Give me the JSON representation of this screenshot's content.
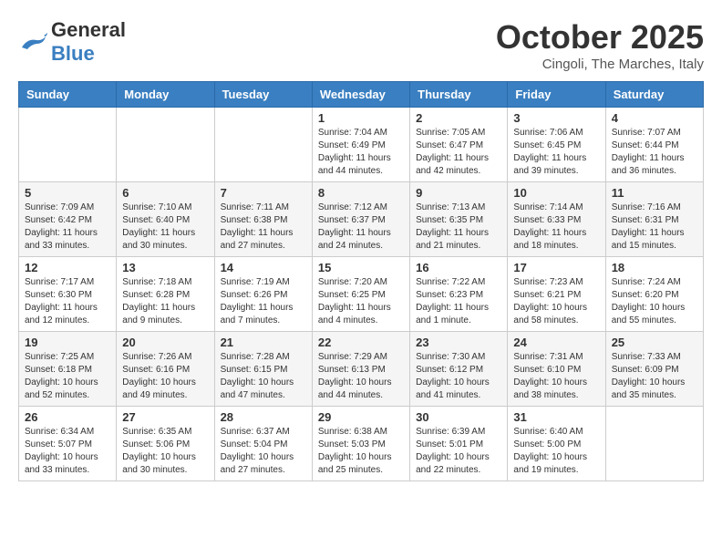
{
  "header": {
    "logo_general": "General",
    "logo_blue": "Blue",
    "month": "October 2025",
    "location": "Cingoli, The Marches, Italy"
  },
  "weekdays": [
    "Sunday",
    "Monday",
    "Tuesday",
    "Wednesday",
    "Thursday",
    "Friday",
    "Saturday"
  ],
  "weeks": [
    [
      {
        "day": "",
        "info": ""
      },
      {
        "day": "",
        "info": ""
      },
      {
        "day": "",
        "info": ""
      },
      {
        "day": "1",
        "info": "Sunrise: 7:04 AM\nSunset: 6:49 PM\nDaylight: 11 hours\nand 44 minutes."
      },
      {
        "day": "2",
        "info": "Sunrise: 7:05 AM\nSunset: 6:47 PM\nDaylight: 11 hours\nand 42 minutes."
      },
      {
        "day": "3",
        "info": "Sunrise: 7:06 AM\nSunset: 6:45 PM\nDaylight: 11 hours\nand 39 minutes."
      },
      {
        "day": "4",
        "info": "Sunrise: 7:07 AM\nSunset: 6:44 PM\nDaylight: 11 hours\nand 36 minutes."
      }
    ],
    [
      {
        "day": "5",
        "info": "Sunrise: 7:09 AM\nSunset: 6:42 PM\nDaylight: 11 hours\nand 33 minutes."
      },
      {
        "day": "6",
        "info": "Sunrise: 7:10 AM\nSunset: 6:40 PM\nDaylight: 11 hours\nand 30 minutes."
      },
      {
        "day": "7",
        "info": "Sunrise: 7:11 AM\nSunset: 6:38 PM\nDaylight: 11 hours\nand 27 minutes."
      },
      {
        "day": "8",
        "info": "Sunrise: 7:12 AM\nSunset: 6:37 PM\nDaylight: 11 hours\nand 24 minutes."
      },
      {
        "day": "9",
        "info": "Sunrise: 7:13 AM\nSunset: 6:35 PM\nDaylight: 11 hours\nand 21 minutes."
      },
      {
        "day": "10",
        "info": "Sunrise: 7:14 AM\nSunset: 6:33 PM\nDaylight: 11 hours\nand 18 minutes."
      },
      {
        "day": "11",
        "info": "Sunrise: 7:16 AM\nSunset: 6:31 PM\nDaylight: 11 hours\nand 15 minutes."
      }
    ],
    [
      {
        "day": "12",
        "info": "Sunrise: 7:17 AM\nSunset: 6:30 PM\nDaylight: 11 hours\nand 12 minutes."
      },
      {
        "day": "13",
        "info": "Sunrise: 7:18 AM\nSunset: 6:28 PM\nDaylight: 11 hours\nand 9 minutes."
      },
      {
        "day": "14",
        "info": "Sunrise: 7:19 AM\nSunset: 6:26 PM\nDaylight: 11 hours\nand 7 minutes."
      },
      {
        "day": "15",
        "info": "Sunrise: 7:20 AM\nSunset: 6:25 PM\nDaylight: 11 hours\nand 4 minutes."
      },
      {
        "day": "16",
        "info": "Sunrise: 7:22 AM\nSunset: 6:23 PM\nDaylight: 11 hours\nand 1 minute."
      },
      {
        "day": "17",
        "info": "Sunrise: 7:23 AM\nSunset: 6:21 PM\nDaylight: 10 hours\nand 58 minutes."
      },
      {
        "day": "18",
        "info": "Sunrise: 7:24 AM\nSunset: 6:20 PM\nDaylight: 10 hours\nand 55 minutes."
      }
    ],
    [
      {
        "day": "19",
        "info": "Sunrise: 7:25 AM\nSunset: 6:18 PM\nDaylight: 10 hours\nand 52 minutes."
      },
      {
        "day": "20",
        "info": "Sunrise: 7:26 AM\nSunset: 6:16 PM\nDaylight: 10 hours\nand 49 minutes."
      },
      {
        "day": "21",
        "info": "Sunrise: 7:28 AM\nSunset: 6:15 PM\nDaylight: 10 hours\nand 47 minutes."
      },
      {
        "day": "22",
        "info": "Sunrise: 7:29 AM\nSunset: 6:13 PM\nDaylight: 10 hours\nand 44 minutes."
      },
      {
        "day": "23",
        "info": "Sunrise: 7:30 AM\nSunset: 6:12 PM\nDaylight: 10 hours\nand 41 minutes."
      },
      {
        "day": "24",
        "info": "Sunrise: 7:31 AM\nSunset: 6:10 PM\nDaylight: 10 hours\nand 38 minutes."
      },
      {
        "day": "25",
        "info": "Sunrise: 7:33 AM\nSunset: 6:09 PM\nDaylight: 10 hours\nand 35 minutes."
      }
    ],
    [
      {
        "day": "26",
        "info": "Sunrise: 6:34 AM\nSunset: 5:07 PM\nDaylight: 10 hours\nand 33 minutes."
      },
      {
        "day": "27",
        "info": "Sunrise: 6:35 AM\nSunset: 5:06 PM\nDaylight: 10 hours\nand 30 minutes."
      },
      {
        "day": "28",
        "info": "Sunrise: 6:37 AM\nSunset: 5:04 PM\nDaylight: 10 hours\nand 27 minutes."
      },
      {
        "day": "29",
        "info": "Sunrise: 6:38 AM\nSunset: 5:03 PM\nDaylight: 10 hours\nand 25 minutes."
      },
      {
        "day": "30",
        "info": "Sunrise: 6:39 AM\nSunset: 5:01 PM\nDaylight: 10 hours\nand 22 minutes."
      },
      {
        "day": "31",
        "info": "Sunrise: 6:40 AM\nSunset: 5:00 PM\nDaylight: 10 hours\nand 19 minutes."
      },
      {
        "day": "",
        "info": ""
      }
    ]
  ]
}
